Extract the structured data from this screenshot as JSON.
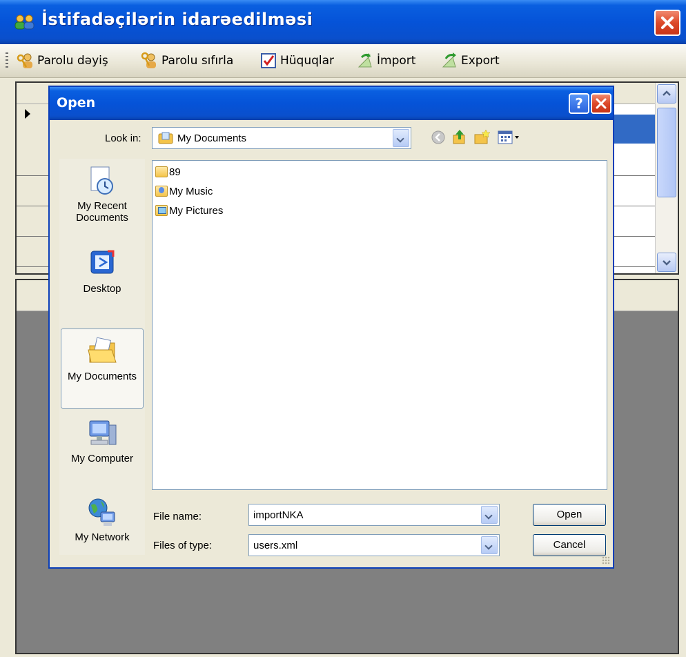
{
  "window": {
    "title": "İstifadəçilərin idarəedilməsi",
    "colors": {
      "titlebar": "#0553d8",
      "close": "#dd4a2a"
    }
  },
  "toolbar": {
    "items": [
      {
        "label": "Parolu dəyiş",
        "icon": "key-user-icon"
      },
      {
        "label": "Parolu sıfırla",
        "icon": "key-reset-icon"
      },
      {
        "label": "Hüquqlar",
        "icon": "checkbox-doc-icon"
      },
      {
        "label": "İmport",
        "icon": "import-icon"
      },
      {
        "label": "Export",
        "icon": "export-icon"
      }
    ]
  },
  "dialog": {
    "title": "Open",
    "help_label": "?",
    "look_in_label": "Look in:",
    "look_in_value": "My Documents",
    "places": [
      {
        "label": "My Recent Documents",
        "icon": "recent-documents-icon"
      },
      {
        "label": "Desktop",
        "icon": "desktop-icon"
      },
      {
        "label": "My Documents",
        "icon": "my-documents-icon",
        "selected": true
      },
      {
        "label": "My Computer",
        "icon": "my-computer-icon"
      },
      {
        "label": "My Network",
        "icon": "my-network-icon"
      }
    ],
    "files": [
      {
        "name": "89",
        "icon": "folder-icon"
      },
      {
        "name": "My Music",
        "icon": "music-folder-icon"
      },
      {
        "name": "My Pictures",
        "icon": "pictures-folder-icon"
      }
    ],
    "file_name_label": "File name:",
    "file_name_value": "importNKA",
    "file_type_label": "Files of type:",
    "file_type_value": "users.xml",
    "open_button": "Open",
    "cancel_button": "Cancel"
  }
}
